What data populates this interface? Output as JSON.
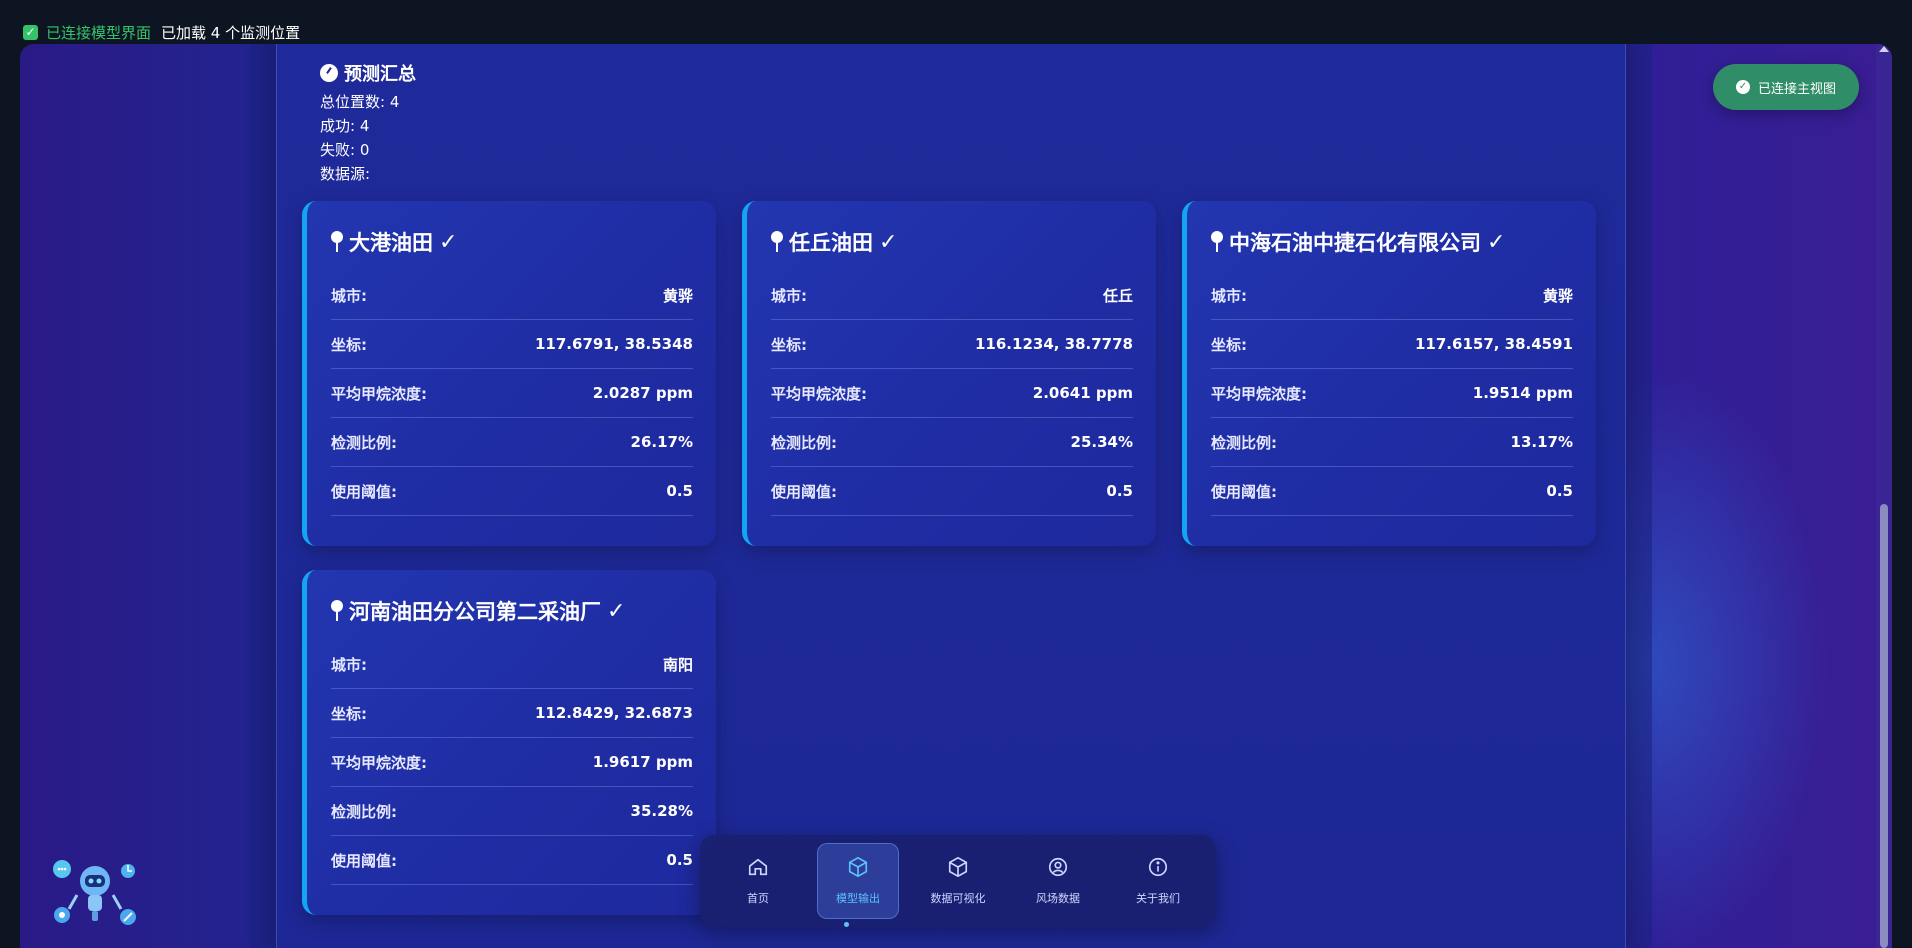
{
  "statusbar": {
    "checkbox_checked": true,
    "connected_label": "已连接模型界面",
    "loaded_label": "已加载 4 个监测位置"
  },
  "toast": {
    "label": "已连接主视图"
  },
  "summary": {
    "title": "预测汇总",
    "total": "总位置数: 4",
    "success": "成功: 4",
    "failed": "失败: 0",
    "source": "数据源:"
  },
  "field_labels": {
    "city": "城市:",
    "coords": "坐标:",
    "avg": "平均甲烷浓度:",
    "ratio": "检测比例:",
    "threshold": "使用阈值:"
  },
  "cards": [
    {
      "name": "大港油田",
      "status_icon": "check-icon",
      "city": "黄骅",
      "coords": "117.6791, 38.5348",
      "avg": "2.0287 ppm",
      "ratio": "26.17%",
      "threshold": "0.5"
    },
    {
      "name": "任丘油田",
      "status_icon": "check-icon",
      "city": "任丘",
      "coords": "116.1234, 38.7778",
      "avg": "2.0641 ppm",
      "ratio": "25.34%",
      "threshold": "0.5"
    },
    {
      "name": "中海石油中捷石化有限公司",
      "status_icon": "check-icon",
      "city": "黄骅",
      "coords": "117.6157, 38.4591",
      "avg": "1.9514 ppm",
      "ratio": "13.17%",
      "threshold": "0.5"
    },
    {
      "name": "河南油田分公司第二采油厂",
      "status_icon": "check-icon",
      "city": "南阳",
      "coords": "112.8429, 32.6873",
      "avg": "1.9617 ppm",
      "ratio": "35.28%",
      "threshold": "0.5"
    }
  ],
  "nav": [
    {
      "label": "首页",
      "icon": "home-icon",
      "active": false
    },
    {
      "label": "模型输出",
      "icon": "cube-icon",
      "active": true
    },
    {
      "label": "数据可视化",
      "icon": "cube-outline-icon",
      "active": false
    },
    {
      "label": "风场数据",
      "icon": "target-icon",
      "active": false
    },
    {
      "label": "关于我们",
      "icon": "info-icon",
      "active": false
    }
  ],
  "colors": {
    "accent_blue": "#14a4f3",
    "success_green": "#34c36a",
    "toast_green": "#2f8e68",
    "active_nav": "#5fc0ff"
  }
}
